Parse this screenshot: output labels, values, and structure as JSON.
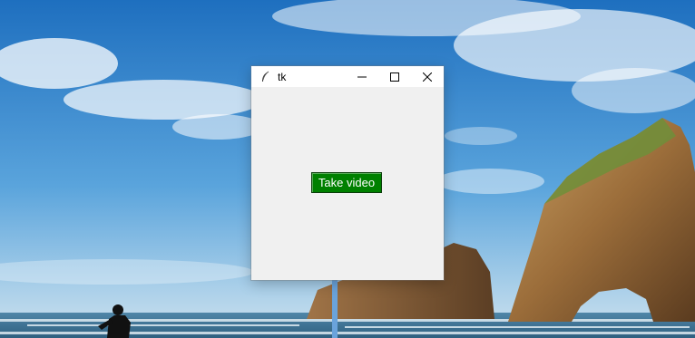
{
  "window": {
    "title": "tk",
    "controls": {
      "minimize_icon": "minimize-icon",
      "maximize_icon": "maximize-icon",
      "close_icon": "close-icon"
    }
  },
  "main": {
    "button_label": "Take video",
    "button_color": "#008000",
    "button_text_color": "#ffffff"
  },
  "desktop": {
    "wallpaper": "beach-sea-rocks-wallpaper"
  }
}
